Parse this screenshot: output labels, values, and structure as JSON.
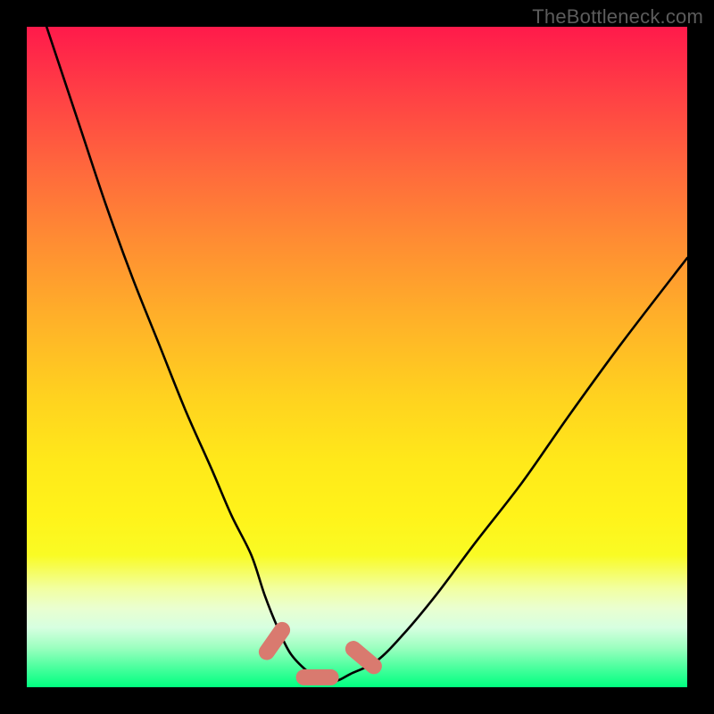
{
  "watermark": "TheBottleneck.com",
  "chart_data": {
    "type": "line",
    "title": "",
    "xlabel": "",
    "ylabel": "",
    "xlim": [
      0,
      100
    ],
    "ylim": [
      0,
      100
    ],
    "series": [
      {
        "name": "bottleneck-curve",
        "x": [
          3,
          8,
          12,
          16,
          20,
          24,
          28,
          31,
          34,
          36,
          38,
          40,
          43,
          45,
          47,
          49,
          53,
          57,
          62,
          68,
          75,
          82,
          90,
          100
        ],
        "values": [
          100,
          85,
          73,
          62,
          52,
          42,
          33,
          26,
          20,
          14,
          9,
          5,
          2,
          1,
          1,
          2,
          4,
          8,
          14,
          22,
          31,
          41,
          52,
          65
        ]
      }
    ],
    "markers": [
      {
        "name": "pill-left",
        "x": 37.5,
        "y": 7,
        "angle_deg": -55
      },
      {
        "name": "pill-bottom",
        "x": 44,
        "y": 1.5,
        "angle_deg": 0
      },
      {
        "name": "pill-right",
        "x": 51,
        "y": 4.5,
        "angle_deg": 40
      }
    ],
    "colors": {
      "curve": "#000000",
      "pill": "#d97a6f",
      "gradient_top": "#ff1a4b",
      "gradient_bottom": "#00ff80",
      "background": "#000000"
    }
  }
}
